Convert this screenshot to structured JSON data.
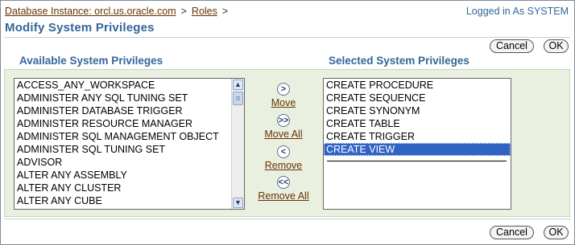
{
  "breadcrumb": {
    "instance_link": "Database Instance: orcl.us.oracle.com",
    "separator": ">",
    "roles_link": "Roles",
    "trailing_separator": ">"
  },
  "session": {
    "logged_in_text": "Logged in As SYSTEM"
  },
  "page": {
    "title": "Modify System Privileges"
  },
  "buttons": {
    "cancel": "Cancel",
    "ok": "OK"
  },
  "available": {
    "heading": "Available System Privileges",
    "items": [
      "ACCESS_ANY_WORKSPACE",
      "ADMINISTER ANY SQL TUNING SET",
      "ADMINISTER DATABASE TRIGGER",
      "ADMINISTER RESOURCE MANAGER",
      "ADMINISTER SQL MANAGEMENT OBJECT",
      "ADMINISTER SQL TUNING SET",
      "ADVISOR",
      "ALTER ANY ASSEMBLY",
      "ALTER ANY CLUSTER",
      "ALTER ANY CUBE"
    ]
  },
  "shuttle": {
    "move": {
      "icon": ">",
      "label": "Move"
    },
    "move_all": {
      "icon": ">>",
      "label": "Move All"
    },
    "remove": {
      "icon": "<",
      "label": "Remove"
    },
    "remove_all": {
      "icon": "<<",
      "label": "Remove All"
    }
  },
  "selected": {
    "heading": "Selected System Privileges",
    "items": [
      "CREATE PROCEDURE",
      "CREATE SEQUENCE",
      "CREATE SYNONYM",
      "CREATE TABLE",
      "CREATE TRIGGER",
      "CREATE VIEW"
    ],
    "highlighted_item": "CREATE VIEW"
  },
  "colors": {
    "heading": "#336699",
    "link": "#663300",
    "panel_bg": "#eaf0e0",
    "selection_bg": "#3163c3"
  }
}
